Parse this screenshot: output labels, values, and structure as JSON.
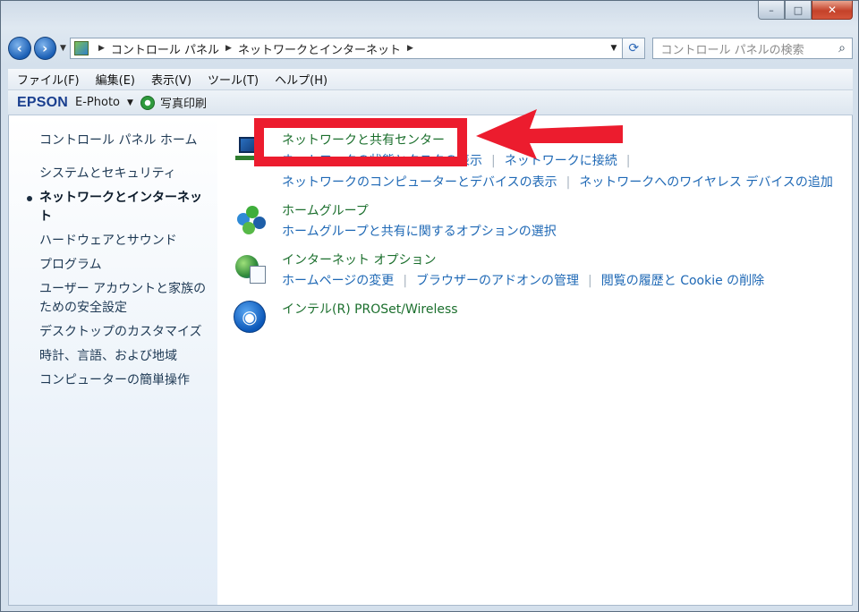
{
  "window": {
    "caption_buttons": [
      "–",
      "□",
      "✕"
    ]
  },
  "nav": {
    "breadcrumb": [
      "コントロール パネル",
      "ネットワークとインターネット"
    ],
    "search_placeholder": "コントロール パネルの検索"
  },
  "menubar": {
    "items": [
      "ファイル(F)",
      "編集(E)",
      "表示(V)",
      "ツール(T)",
      "ヘルプ(H)"
    ]
  },
  "toolbar": {
    "brand": "EPSON",
    "app": "E-Photo",
    "print_label": "写真印刷"
  },
  "sidebar": {
    "items": [
      "コントロール パネル ホーム",
      "システムとセキュリティ",
      "ネットワークとインターネット",
      "ハードウェアとサウンド",
      "プログラム",
      "ユーザー アカウントと家族のための安全設定",
      "デスクトップのカスタマイズ",
      "時計、言語、および地域",
      "コンピューターの簡単操作"
    ],
    "active_index": 2
  },
  "categories": [
    {
      "icon": "network-center-icon",
      "title": "ネットワークと共有センター",
      "links": [
        "ネットワークの状態とタスクの表示",
        "ネットワークに接続",
        "ネットワークのコンピューターとデバイスの表示",
        "ネットワークへのワイヤレス デバイスの追加"
      ]
    },
    {
      "icon": "homegroup-icon",
      "title": "ホームグループ",
      "links": [
        "ホームグループと共有に関するオプションの選択"
      ]
    },
    {
      "icon": "internet-options-icon",
      "title": "インターネット オプション",
      "links": [
        "ホームページの変更",
        "ブラウザーのアドオンの管理",
        "閲覧の履歴と Cookie の削除"
      ]
    },
    {
      "icon": "wireless-icon",
      "title": "インテル(R) PROSet/Wireless",
      "links": []
    }
  ],
  "annotation": {
    "color": "#ec1c2e"
  }
}
